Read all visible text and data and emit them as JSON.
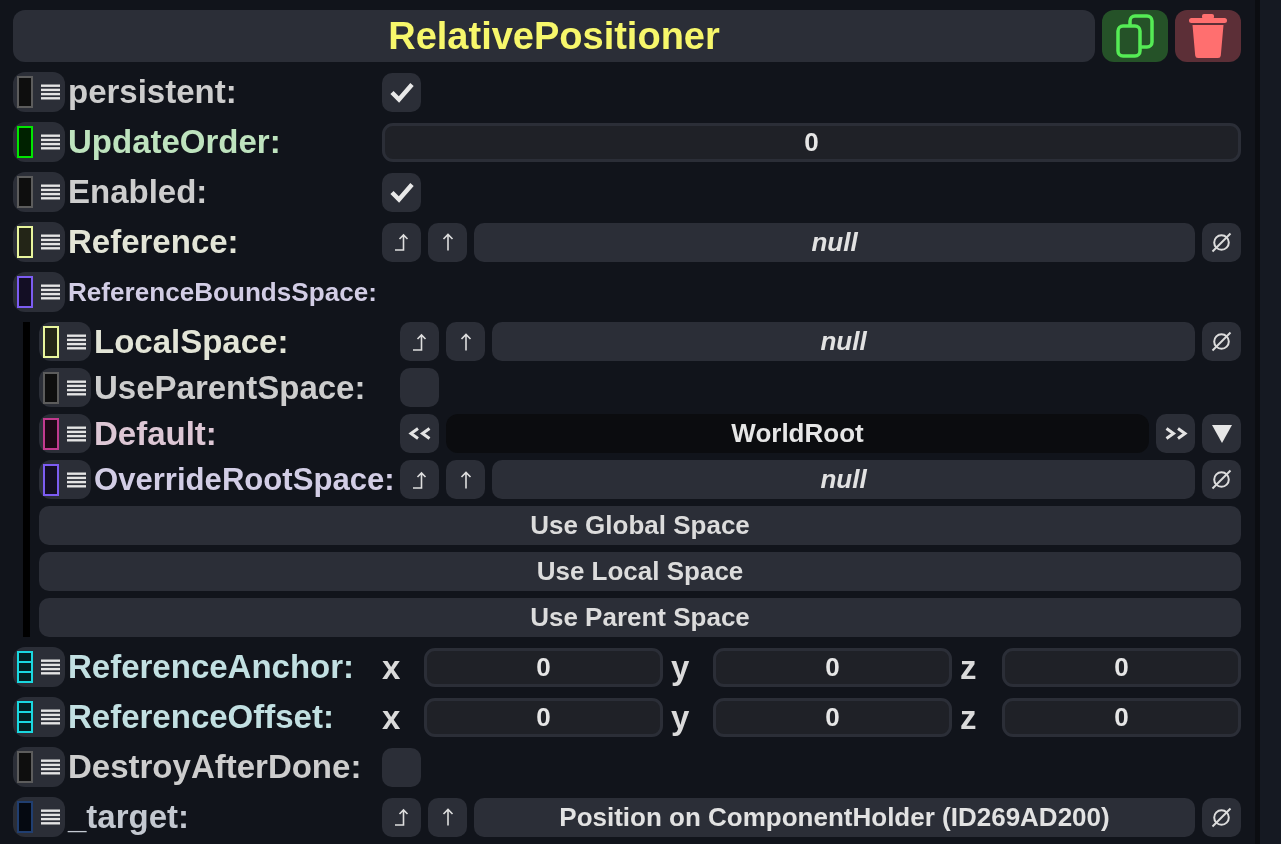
{
  "header": {
    "title": "RelativePositioner"
  },
  "fields": [
    {
      "kind": "checkbox",
      "label": "persistent:",
      "color": "#5c5c5c",
      "checked": true
    },
    {
      "kind": "number",
      "label": "UpdateOrder:",
      "color": "#00e600",
      "value": "0"
    },
    {
      "kind": "checkbox",
      "label": "Enabled:",
      "color": "#5c5c5c",
      "checked": true
    },
    {
      "kind": "reference",
      "label": "Reference:",
      "color": "#e8f59c",
      "value": "null",
      "empty": true
    },
    {
      "kind": "group",
      "label": "ReferenceBoundsSpace:",
      "color": "#7c5cf2",
      "children": [
        {
          "kind": "reference",
          "label": "LocalSpace:",
          "color": "#e8f59c",
          "value": "null",
          "empty": true
        },
        {
          "kind": "checkbox",
          "label": "UseParentSpace:",
          "color": "#5c5c5c",
          "checked": false
        },
        {
          "kind": "enum",
          "label": "Default:",
          "color": "#c23a8e",
          "value": "WorldRoot"
        },
        {
          "kind": "reference",
          "label": "OverrideRootSpace:",
          "color": "#7c5cf2",
          "value": "null",
          "empty": true
        }
      ],
      "buttons": [
        "Use Global Space",
        "Use Local Space",
        "Use Parent Space"
      ]
    },
    {
      "kind": "vector",
      "label": "ReferenceAnchor:",
      "color": "#1ad8e0",
      "components": [
        {
          "axis": "x",
          "value": "0"
        },
        {
          "axis": "y",
          "value": "0"
        },
        {
          "axis": "z",
          "value": "0"
        }
      ]
    },
    {
      "kind": "vector",
      "label": "ReferenceOffset:",
      "color": "#1ad8e0",
      "components": [
        {
          "axis": "x",
          "value": "0"
        },
        {
          "axis": "y",
          "value": "0"
        },
        {
          "axis": "z",
          "value": "0"
        }
      ]
    },
    {
      "kind": "checkbox",
      "label": "DestroyAfterDone:",
      "color": "#5c5c5c",
      "checked": false
    },
    {
      "kind": "reference",
      "label": "_target:",
      "color": "#203e70",
      "value": "Position on ComponentHolder (ID269AD200)",
      "empty": false
    }
  ]
}
